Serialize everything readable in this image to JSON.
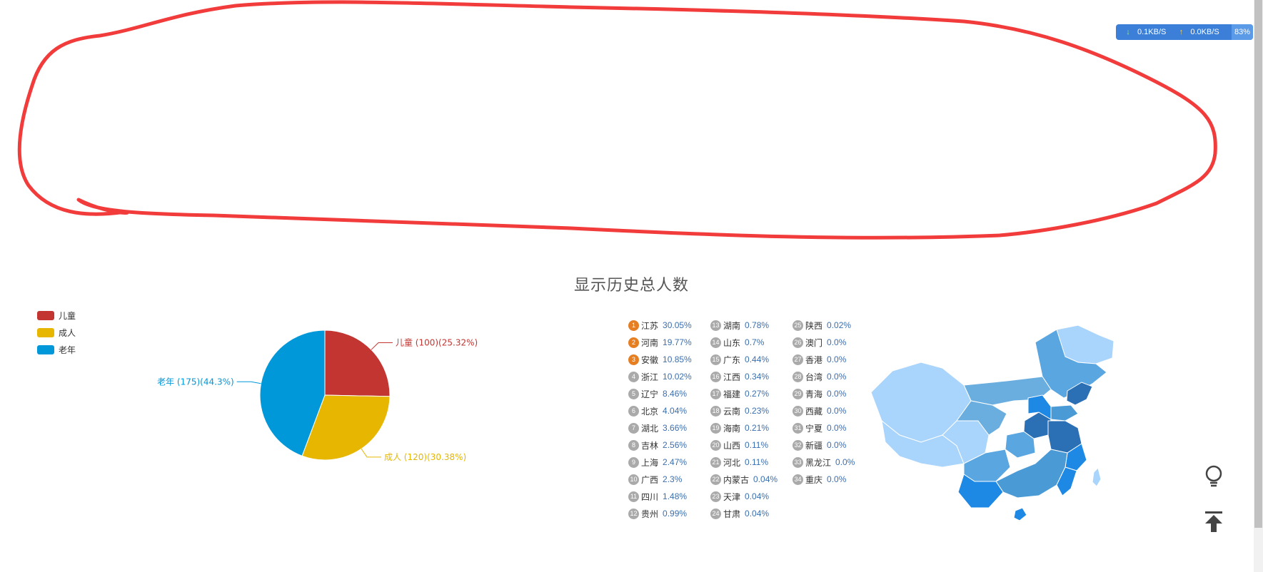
{
  "net_badge": {
    "down": "0.1KB/S",
    "up": "0.0KB/S",
    "percent": "83%"
  },
  "colors": {
    "annotation": "#f23b3b",
    "child": "#c23531",
    "adult": "#e6b600",
    "senior": "#0098d9"
  },
  "chart_data": [
    {
      "type": "pie",
      "title": "显示历史总人数",
      "legend": {
        "placement": "top-left",
        "entries": [
          "儿童",
          "成人",
          "老年"
        ]
      },
      "slices": [
        {
          "name": "儿童",
          "value": 100,
          "percent": 25.32,
          "label": "儿童 (100)(25.32%)"
        },
        {
          "name": "成人",
          "value": 120,
          "percent": 30.38,
          "label": "成人 (120)(30.38%)"
        },
        {
          "name": "老年",
          "value": 175,
          "percent": 44.3,
          "label": "老年 (175)(44.3%)"
        }
      ]
    },
    {
      "type": "table",
      "columns": [
        "rank",
        "province",
        "percent"
      ],
      "rows": [
        [
          "1",
          "江苏",
          "30.05%"
        ],
        [
          "2",
          "河南",
          "19.77%"
        ],
        [
          "3",
          "安徽",
          "10.85%"
        ],
        [
          "4",
          "浙江",
          "10.02%"
        ],
        [
          "5",
          "辽宁",
          "8.46%"
        ],
        [
          "6",
          "北京",
          "4.04%"
        ],
        [
          "7",
          "湖北",
          "3.66%"
        ],
        [
          "8",
          "吉林",
          "2.56%"
        ],
        [
          "9",
          "上海",
          "2.47%"
        ],
        [
          "10",
          "广西",
          "2.3%"
        ],
        [
          "11",
          "四川",
          "1.48%"
        ],
        [
          "12",
          "贵州",
          "0.99%"
        ],
        [
          "13",
          "湖南",
          "0.78%"
        ],
        [
          "14",
          "山东",
          "0.7%"
        ],
        [
          "15",
          "广东",
          "0.44%"
        ],
        [
          "16",
          "江西",
          "0.34%"
        ],
        [
          "17",
          "福建",
          "0.27%"
        ],
        [
          "18",
          "云南",
          "0.23%"
        ],
        [
          "19",
          "海南",
          "0.21%"
        ],
        [
          "20",
          "山西",
          "0.11%"
        ],
        [
          "21",
          "河北",
          "0.11%"
        ],
        [
          "22",
          "内蒙古",
          "0.04%"
        ],
        [
          "23",
          "天津",
          "0.04%"
        ],
        [
          "24",
          "甘肃",
          "0.04%"
        ],
        [
          "25",
          "陕西",
          "0.02%"
        ],
        [
          "26",
          "澳门",
          "0.0%"
        ],
        [
          "27",
          "香港",
          "0.0%"
        ],
        [
          "28",
          "台湾",
          "0.0%"
        ],
        [
          "29",
          "青海",
          "0.0%"
        ],
        [
          "30",
          "西藏",
          "0.0%"
        ],
        [
          "31",
          "宁夏",
          "0.0%"
        ],
        [
          "32",
          "新疆",
          "0.0%"
        ],
        [
          "33",
          "黑龙江",
          "0.0%"
        ],
        [
          "34",
          "重庆",
          "0.0%"
        ]
      ]
    }
  ],
  "side_buttons": {
    "tip_icon": "lightbulb-icon",
    "top_icon": "back-to-top-icon"
  }
}
